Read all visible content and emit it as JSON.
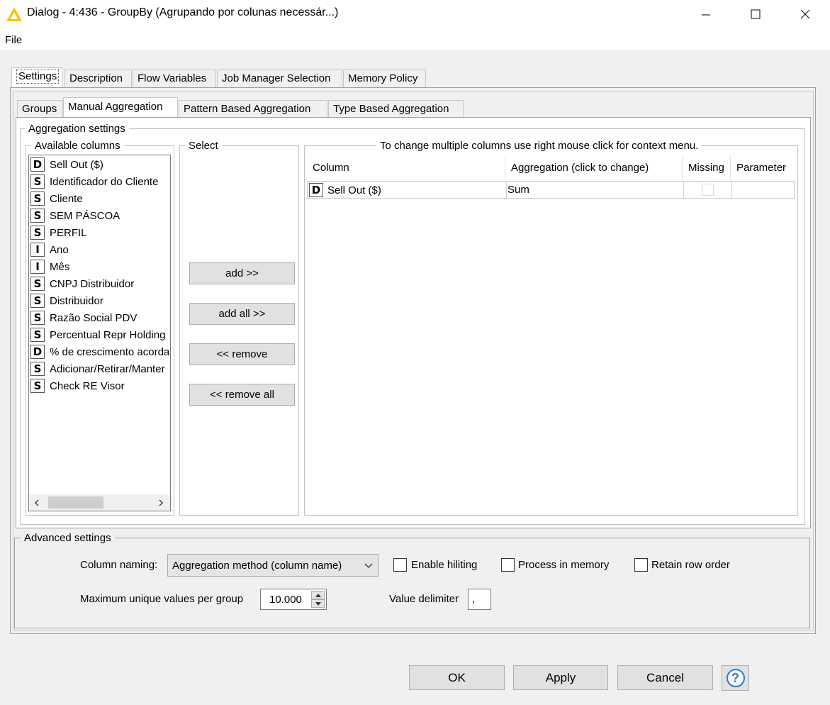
{
  "window": {
    "title": "Dialog - 4:436 - GroupBy (Agrupando por colunas necessár...)"
  },
  "menu": {
    "file": "File"
  },
  "outer_tabs": [
    {
      "label": "Settings"
    },
    {
      "label": "Description"
    },
    {
      "label": "Flow Variables"
    },
    {
      "label": "Job Manager Selection"
    },
    {
      "label": "Memory Policy"
    }
  ],
  "inner_tabs": [
    {
      "label": "Groups"
    },
    {
      "label": "Manual Aggregation"
    },
    {
      "label": "Pattern Based Aggregation"
    },
    {
      "label": "Type Based Aggregation"
    }
  ],
  "aggregation_settings": {
    "legend": "Aggregation settings",
    "available_legend": "Available columns",
    "select_legend": "Select",
    "table_legend": "To change multiple columns use right mouse click for context menu."
  },
  "available_columns": [
    {
      "type": "D",
      "name": "Sell Out ($)"
    },
    {
      "type": "S",
      "name": "Identificador do Cliente"
    },
    {
      "type": "S",
      "name": "Cliente"
    },
    {
      "type": "S",
      "name": "SEM PÁSCOA"
    },
    {
      "type": "S",
      "name": "PERFIL"
    },
    {
      "type": "I",
      "name": "Ano"
    },
    {
      "type": "I",
      "name": "Mês"
    },
    {
      "type": "S",
      "name": "CNPJ Distribuidor"
    },
    {
      "type": "S",
      "name": "Distribuidor"
    },
    {
      "type": "S",
      "name": "Razão Social PDV"
    },
    {
      "type": "S",
      "name": "Percentual Repr Holding"
    },
    {
      "type": "D",
      "name": "% de crescimento acordado"
    },
    {
      "type": "S",
      "name": "Adicionar/Retirar/Manter"
    },
    {
      "type": "S",
      "name": "Check RE Visor"
    }
  ],
  "select_buttons": {
    "add": "add >>",
    "add_all": "add all >>",
    "remove": "<< remove",
    "remove_all": "<< remove all"
  },
  "agg_table": {
    "headers": {
      "column": "Column",
      "aggregation": "Aggregation (click to change)",
      "missing": "Missing",
      "parameter": "Parameter"
    },
    "rows": [
      {
        "type": "D",
        "column": "Sell Out ($)",
        "aggregation": "Sum",
        "missing": false,
        "parameter": ""
      }
    ]
  },
  "advanced": {
    "legend": "Advanced settings",
    "column_naming_label": "Column naming:",
    "column_naming_value": "Aggregation method (column name)",
    "enable_hiliting": "Enable hiliting",
    "process_in_memory": "Process in memory",
    "retain_row_order": "Retain row order",
    "max_unique_label": "Maximum unique values per group",
    "max_unique_value": "10.000",
    "value_delimiter_label": "Value delimiter",
    "value_delimiter_value": ","
  },
  "footer": {
    "ok": "OK",
    "apply": "Apply",
    "cancel": "Cancel",
    "help_glyph": "?"
  }
}
